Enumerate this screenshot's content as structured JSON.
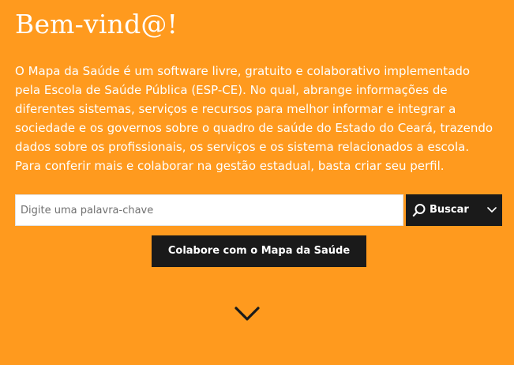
{
  "hero": {
    "title": "Bem-vind@!",
    "intro": "O Mapa da Saúde é um software livre, gratuito e colaborativo implementado pela Escola de Saúde Pública (ESP-CE). No qual, abrange informações de diferentes sistemas, serviços e recursos para melhor informar e integrar a sociedade e os governos sobre o quadro de saúde do Estado do Ceará, trazendo dados sobre os profissionais, os serviços e os sistema relacionados a escola. Para conferir mais e colaborar na gestão estadual, basta criar seu perfil."
  },
  "search": {
    "placeholder": "Digite uma palavra-chave",
    "value": "",
    "button_label": "Buscar",
    "search_icon": "search-icon",
    "dropdown_icon": "chevron-down-icon"
  },
  "cta": {
    "label": "Colabore com o Mapa da Saúde"
  },
  "scroll": {
    "icon": "chevron-down-icon"
  },
  "colors": {
    "background": "#FF9A1E",
    "text": "#FFFFFF",
    "button_bg": "#1A1A1A",
    "input_bg": "#FFFFFF"
  }
}
